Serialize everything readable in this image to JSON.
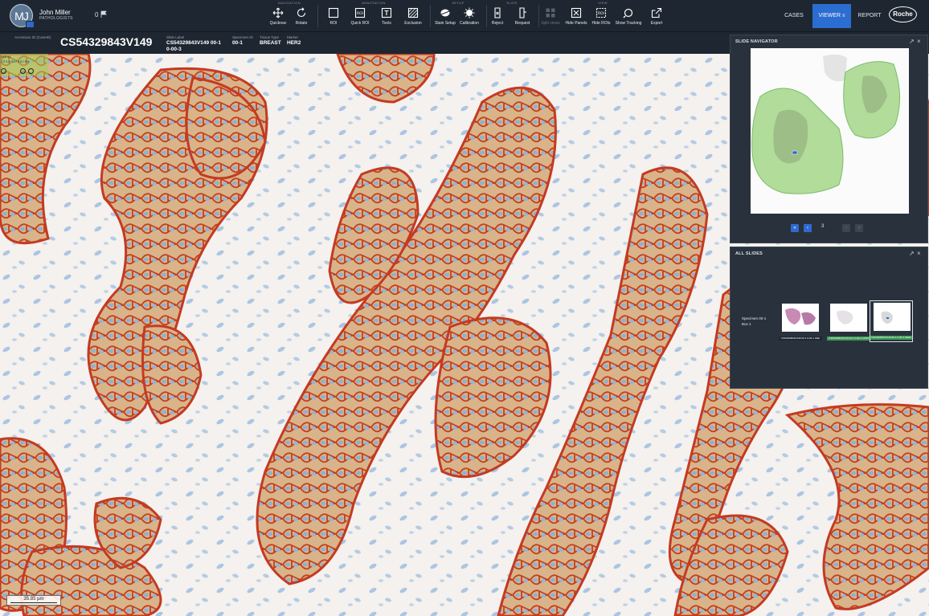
{
  "user": {
    "initials": "MJ",
    "name": "John Miller",
    "role": "PATHOLOGISTS",
    "flag_count": "0"
  },
  "toolbar": {
    "groups": {
      "navigation": "NAVIGATION",
      "annotation": "ANNOTATION",
      "setup": "SETUP",
      "slide": "SLIDE",
      "view": "VIEW"
    },
    "tools": {
      "quicknav": "Quicknav",
      "rotate": "Rotate",
      "roi": "ROI",
      "quick_roi": "Quick ROI",
      "tools": "Tools",
      "exclusion": "Exclusion",
      "stain_setup": "Stain Setup",
      "calibration": "Calibration",
      "reject": "Reject",
      "request": "Request",
      "split_views": "Split views",
      "hide_panels": "Hide Panels",
      "hide_rois": "Hide ROIs",
      "show_tracking": "Show Tracking",
      "export": "Export"
    },
    "nav": {
      "cases": "CASES",
      "viewer": "VIEWER",
      "report": "REPORT"
    },
    "brand": "Roche"
  },
  "info": {
    "accession_label": "Accession ID (CaseID)",
    "accession_id": "CS54329843V149",
    "slide_label": "Slide Label",
    "slide_value_1": "CS54329843V149 00-1",
    "slide_value_2": "0-00-3",
    "specimen_label": "Specimen ID",
    "specimen_value": "00-1",
    "tissue_label": "Tissue Type",
    "tissue_value": "BREAST",
    "marker_label": "Marker",
    "marker_value": "HER2"
  },
  "overlay": {
    "line1": "ROI #1",
    "line2": "CT 1 0 00 / 0 0 / 0%"
  },
  "scalebar": {
    "label": "35.85 µm"
  },
  "slide_navigator": {
    "title": "SLIDE NAVIGATOR",
    "current_page": "3"
  },
  "all_slides": {
    "title": "ALL SLIDES",
    "specimen_line1": "Specimen 00-1",
    "specimen_line2": "Box 1",
    "slides": [
      {
        "caption": "CS54329843V149 00-1 0-00-1 H&E",
        "status": "default"
      },
      {
        "caption": "CS54329843V149 00-1 0-00-2 CK5/6",
        "status": "green"
      },
      {
        "caption": "CS54329843V149 00-1 0-00-3 HER2",
        "status": "green"
      }
    ]
  },
  "colors": {
    "toolbar_bg": "#1e2731",
    "accent_blue": "#2b6dd0",
    "membrane_red": "#c43a22",
    "dab_brown": "#b07a3a",
    "nuclei_blue": "#8fb2d6",
    "roi_green": "#9ccf7e"
  },
  "icons": [
    "avatar-badge-icon",
    "flag-icon",
    "move-icon",
    "rotate-icon",
    "square-icon",
    "roi-icon",
    "text-tool-icon",
    "hatch-icon",
    "stain-icon",
    "calibration-icon",
    "reject-icon",
    "request-icon",
    "split-views-icon",
    "hide-panels-icon",
    "hide-rois-icon",
    "tracking-icon",
    "export-icon",
    "expand-icon",
    "close-icon",
    "chevron-first-icon",
    "chevron-prev-icon",
    "chevron-next-icon",
    "chevron-last-icon"
  ]
}
